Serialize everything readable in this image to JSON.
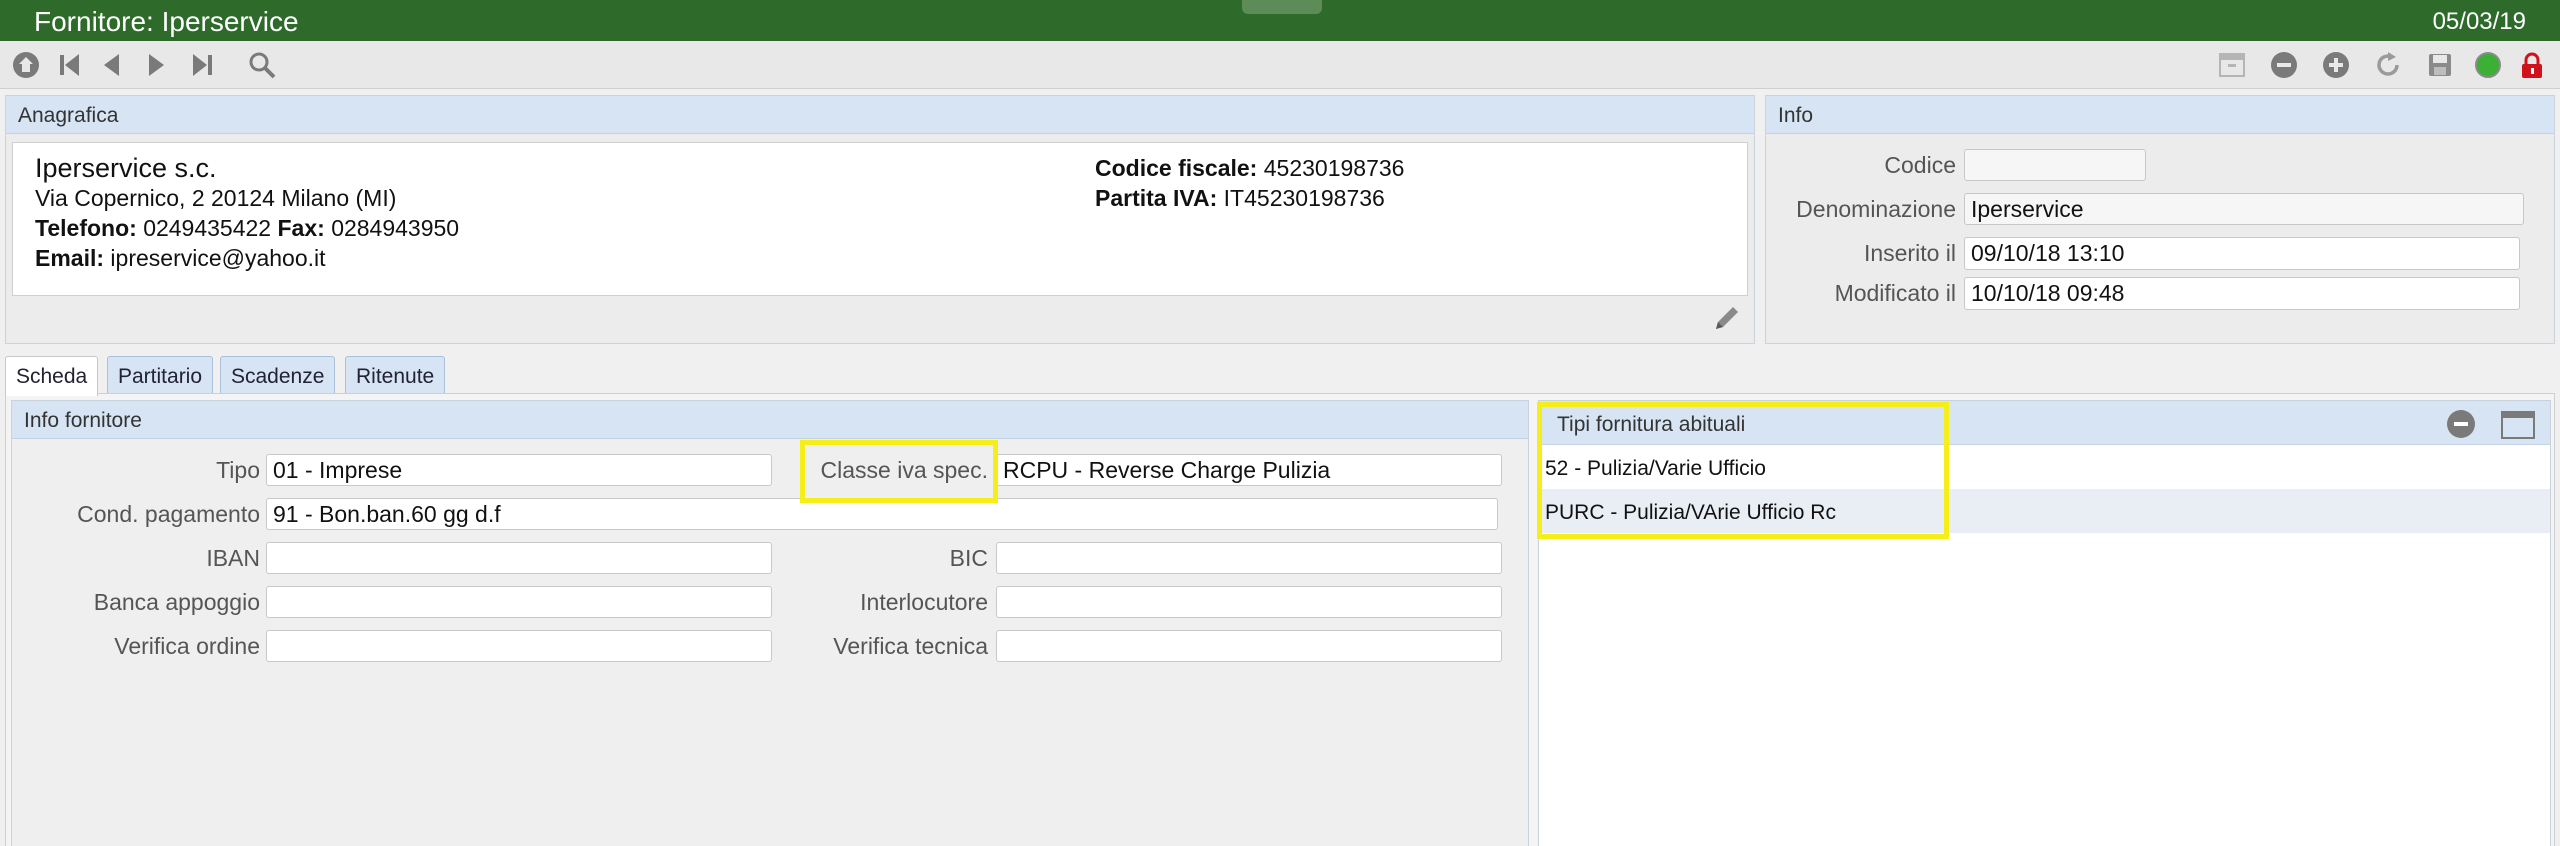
{
  "window": {
    "title": "Fornitore: Iperservice",
    "date": "05/03/19"
  },
  "toolbar": {
    "left_icons": [
      "home-icon",
      "first-record-icon",
      "prev-record-icon",
      "next-record-icon",
      "last-record-icon",
      "search-icon"
    ],
    "right_icons": [
      "archive-icon",
      "remove-icon",
      "add-icon",
      "refresh-icon",
      "save-icon",
      "status-icon",
      "lock-icon"
    ]
  },
  "anagrafica": {
    "header": "Anagrafica",
    "company": "Iperservice s.c.",
    "address": "Via Copernico, 2 20124 Milano (MI)",
    "phone_label": "Telefono:",
    "phone": "0249435422",
    "fax_label": "Fax:",
    "fax": "0284943950",
    "email_label": "Email:",
    "email": "ipreservice@yahoo.it",
    "cf_label": "Codice fiscale:",
    "cf": "45230198736",
    "piva_label": "Partita IVA:",
    "piva": "IT45230198736"
  },
  "info": {
    "header": "Info",
    "codice_label": "Codice",
    "codice": "",
    "denominazione_label": "Denominazione",
    "denominazione": "Iperservice",
    "inserito_label": "Inserito il",
    "inserito": "09/10/18 13:10",
    "modificato_label": "Modificato il",
    "modificato": "10/10/18 09:48"
  },
  "tabs": [
    "Scheda",
    "Partitario",
    "Scadenze",
    "Ritenute"
  ],
  "info_fornitore": {
    "header": "Info fornitore",
    "tipo_label": "Tipo",
    "tipo": "01 - Imprese",
    "classe_label": "Classe iva spec.",
    "classe": "RCPU - Reverse Charge Pulizia",
    "cond_label": "Cond. pagamento",
    "cond": "91 - Bon.ban.60 gg d.f",
    "iban_label": "IBAN",
    "iban": "",
    "bic_label": "BIC",
    "bic": "",
    "banca_label": "Banca appoggio",
    "banca": "",
    "interlocutore_label": "Interlocutore",
    "interlocutore": "",
    "verifica_ordine_label": "Verifica ordine",
    "verifica_ordine": "",
    "verifica_tecnica_label": "Verifica tecnica",
    "verifica_tecnica": ""
  },
  "tipi_fornitura": {
    "header": "Tipi fornitura abituali",
    "items": [
      "52 - Pulizia/Varie Ufficio",
      "PURC - Pulizia/VArie Ufficio Rc"
    ]
  },
  "colors": {
    "titlebar": "#2e6a2a",
    "panel_header": "#d6e4f3",
    "highlight": "#f6ee1b",
    "lock": "#d0101a",
    "status": "#3cb034"
  }
}
